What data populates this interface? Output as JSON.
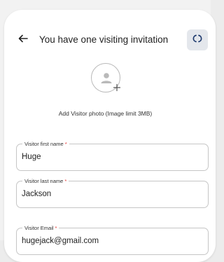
{
  "header": {
    "title": "You have one visiting invitation",
    "back_icon": "arrow-left-icon",
    "refresh_icon": "refresh-icon"
  },
  "photo": {
    "caption": "Add Visitor photo (Image limit 3MB)",
    "icon": "add-person-icon"
  },
  "form": {
    "first_name": {
      "label": "Visitor first name",
      "required_mark": "*",
      "value": "Huge"
    },
    "last_name": {
      "label": "Visitor last name",
      "required_mark": "*",
      "value": "Jackson"
    },
    "email": {
      "label": "Visitor Email",
      "required_mark": "*",
      "value": "hugejack@gmail.com"
    }
  },
  "colors": {
    "required": "#e53935",
    "refresh_bg": "#e4e7ec",
    "border": "#c6c6c6"
  }
}
